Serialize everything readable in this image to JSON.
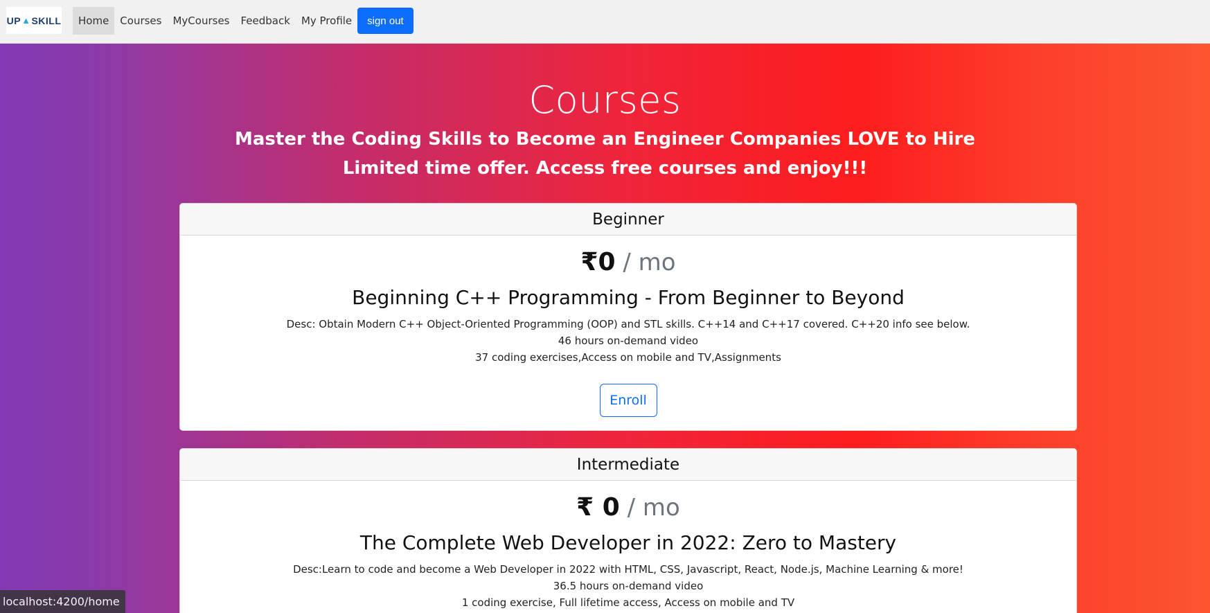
{
  "navbar": {
    "logo": {
      "prefix": "UP",
      "suffix": "SKILL"
    },
    "items": [
      {
        "label": "Home",
        "active": true
      },
      {
        "label": "Courses"
      },
      {
        "label": "MyCourses"
      },
      {
        "label": "Feedback"
      },
      {
        "label": "My Profile"
      }
    ],
    "signout_label": "sign out"
  },
  "hero": {
    "title": "Courses",
    "subtitle_1": "Master the Coding Skills to Become an Engineer Companies LOVE to Hire",
    "subtitle_2": "Limited time offer. Access free courses and enjoy!!!"
  },
  "cards": [
    {
      "level": "Beginner",
      "price": "₹0",
      "per": " / mo",
      "title": "Beginning C++ Programming - From Beginner to Beyond",
      "desc": "Desc: Obtain Modern C++ Object-Oriented Programming (OOP) and STL skills. C++14 and C++17 covered. C++20 info see below.",
      "hours": "46 hours on-demand video",
      "extras": "37 coding exercises,Access on mobile and TV,Assignments",
      "button": "Enroll"
    },
    {
      "level": "Intermediate",
      "price": "₹ 0",
      "per": " / mo",
      "title": "The Complete Web Developer in 2022: Zero to Mastery",
      "desc": "Desc:Learn to code and become a Web Developer in 2022 with HTML, CSS, Javascript, React, Node.js, Machine Learning & more!",
      "hours": "36.5 hours on-demand video",
      "extras": "1 coding exercise, Full lifetime access, Access on mobile and TV"
    }
  ],
  "statusbar": {
    "url": "localhost:4200/home"
  },
  "colors": {
    "accent": "#0d6efd",
    "gradient_start": "#833ab4",
    "gradient_mid": "#fd1d1d",
    "gradient_end": "#fc5530"
  }
}
